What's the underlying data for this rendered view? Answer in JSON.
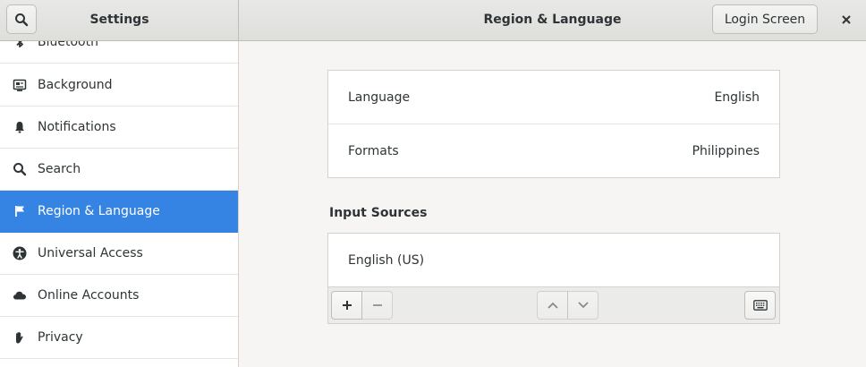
{
  "header": {
    "sidebar_title": "Settings",
    "main_title": "Region & Language",
    "login_screen_label": "Login Screen"
  },
  "sidebar": {
    "items": [
      {
        "label": "Bluetooth",
        "icon": "bluetooth-icon"
      },
      {
        "label": "Background",
        "icon": "background-icon"
      },
      {
        "label": "Notifications",
        "icon": "bell-icon"
      },
      {
        "label": "Search",
        "icon": "search-icon"
      },
      {
        "label": "Region & Language",
        "icon": "flag-icon",
        "active": true
      },
      {
        "label": "Universal Access",
        "icon": "accessibility-icon"
      },
      {
        "label": "Online Accounts",
        "icon": "cloud-icon"
      },
      {
        "label": "Privacy",
        "icon": "hand-icon"
      }
    ]
  },
  "main": {
    "language_label": "Language",
    "language_value": "English",
    "formats_label": "Formats",
    "formats_value": "Philippines",
    "input_sources_title": "Input Sources",
    "input_sources": [
      {
        "label": "English (US)"
      }
    ]
  },
  "colors": {
    "accent": "#3584e4",
    "window_bg": "#f6f5f4",
    "header_bg": "#e8e8e7"
  }
}
